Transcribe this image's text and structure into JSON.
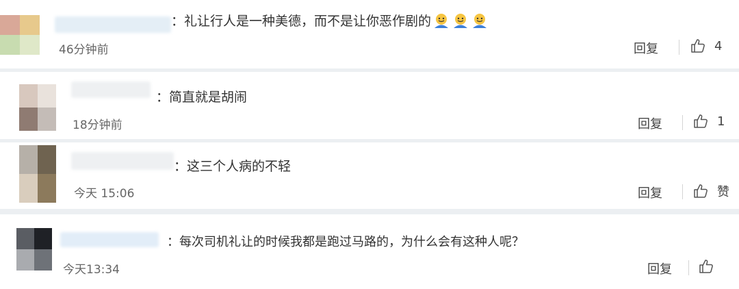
{
  "comments": [
    {
      "text": "：礼让行人是一种美德，而不是让你恶作剧的",
      "emojis": [
        "smiley-icon",
        "smiley-icon",
        "smiley-icon"
      ],
      "time": "46分钟前",
      "reply_label": "回复",
      "like_count": "4"
    },
    {
      "text": "：简直就是胡闹",
      "time": "18分钟前",
      "reply_label": "回复",
      "like_count": "1"
    },
    {
      "text": "：这三个人病的不轻",
      "time": "今天 15:06",
      "reply_label": "回复",
      "like_count": "赞"
    },
    {
      "text": "：每次司机礼让的时候我都是跑过马路的，为什么会有这种人呢？",
      "time": "今天13:34",
      "reply_label": "回复",
      "like_count": ""
    }
  ],
  "colors": {
    "separator": "#eceff2",
    "emoji_face": "#f6c542",
    "emoji_body": "#3d7fd9"
  }
}
